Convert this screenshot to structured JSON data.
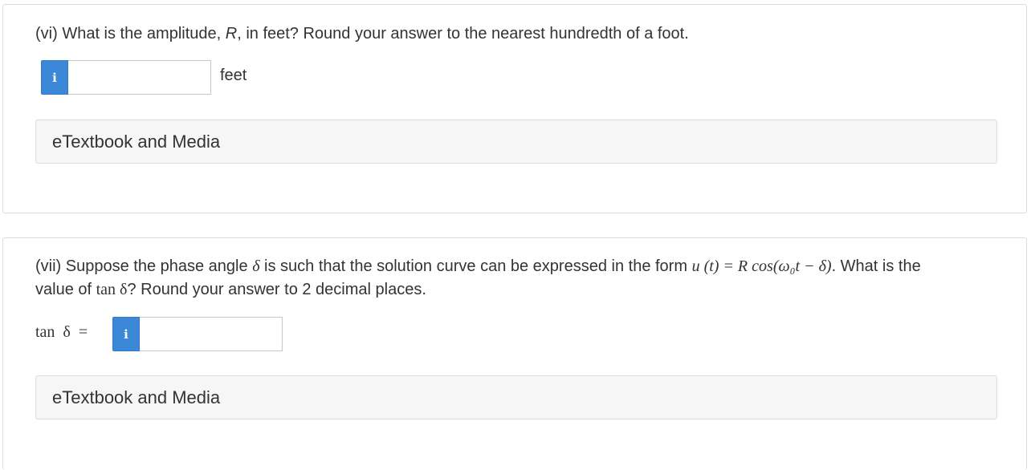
{
  "q6": {
    "prompt_before": "(vi) What is the amplitude, ",
    "prompt_var": "R",
    "prompt_after": ", in feet? Round your answer to the nearest hundredth of a foot.",
    "info_glyph": "i",
    "input_value": "",
    "unit": "feet",
    "etextbook_label": "eTextbook and Media"
  },
  "q7": {
    "line1_text": "(vii) Suppose the phase angle ",
    "delta": "δ",
    "line1_mid": " is such that the solution curve can be expressed in the form ",
    "formula": "u (t)  =  R cos(ω₀t − δ)",
    "line1_end": ". What is the",
    "line2_text": "value of ",
    "tan_delta": "tan  δ",
    "line2_end": "? Round your answer to 2 decimal places.",
    "answer_label": "tan  δ  =",
    "info_glyph": "i",
    "input_value": "",
    "etextbook_label": "eTextbook and Media"
  },
  "colors": {
    "info_button": "#3b87d8",
    "etextbook_bg": "#f6f6f6",
    "text": "#333333"
  },
  "icons": {
    "info": "info-icon"
  }
}
